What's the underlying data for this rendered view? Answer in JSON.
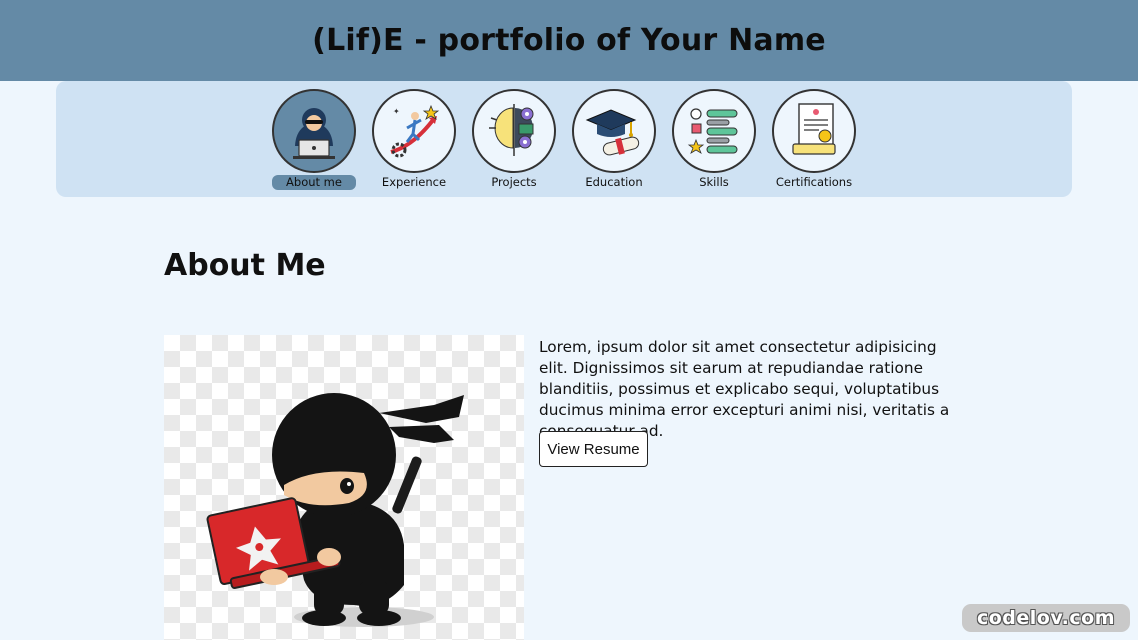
{
  "header": {
    "title": "(Lif)E - portfolio of Your Name"
  },
  "nav": {
    "items": [
      {
        "label": "About me",
        "icon": "hacker-laptop-icon",
        "active": true
      },
      {
        "label": "Experience",
        "icon": "career-growth-icon",
        "active": false
      },
      {
        "label": "Projects",
        "icon": "idea-gears-icon",
        "active": false
      },
      {
        "label": "Education",
        "icon": "graduation-cap-icon",
        "active": false
      },
      {
        "label": "Skills",
        "icon": "skill-bars-icon",
        "active": false
      },
      {
        "label": "Certifications",
        "icon": "certificate-icon",
        "active": false
      }
    ]
  },
  "about": {
    "title": "About Me",
    "text": "Lorem, ipsum dolor sit amet consectetur adipisicing elit. Dignissimos sit earum at repudiandae ratione blanditiis, possimus et explicabo sequi, voluptatibus ducimus minima error excepturi animi nisi, veritatis a consequatur ad.",
    "resume_label": "View Resume",
    "image_icon": "ninja-laptop-illustration"
  },
  "watermark": {
    "text": "codelov.com"
  },
  "colors": {
    "header_bg": "#648aa6",
    "nav_bg": "#cfe2f3",
    "page_bg": "#eef6fd",
    "active_item": "#648aa6"
  }
}
